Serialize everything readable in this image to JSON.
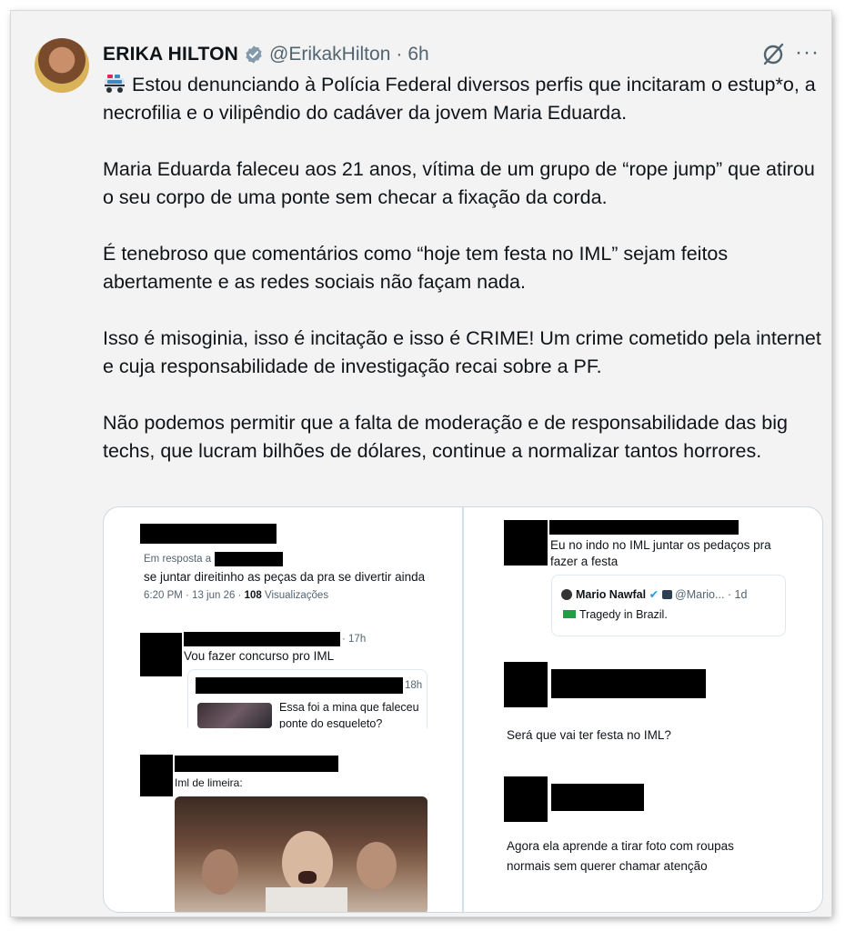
{
  "tweet": {
    "name": "ERIKA HILTON",
    "handle": "@ErikakHilton",
    "separator": "·",
    "time": "6h",
    "more_label": "···",
    "paragraphs": [
      "Estou denunciando à Polícia Federal diversos perfis que incitaram o estup*o, a necrofilia e o vilipêndio do cadáver da jovem Maria Eduarda.",
      "Maria Eduarda faleceu aos 21 anos, vítima de um grupo de “rope jump” que atirou o seu corpo de uma ponte sem checar a fixação da corda.",
      "É tenebroso que comentários como “hoje tem festa no IML” sejam feitos abertamente e as redes sociais não façam nada.",
      "Isso é misoginia, isso é incitação e isso é CRIME! Um crime cometido pela internet e cuja responsabilidade de investigação recai sobre a PF.",
      "Não podemos permitir que a falta de moderação e de responsabilidade das big techs, que lucram bilhões de dólares, continue a normalizar tantos horrores."
    ],
    "first_emoji": "police-car-emoji"
  },
  "media": {
    "left": {
      "post1": {
        "reply_to": "Em resposta a",
        "text": "se juntar direitinho as peças da pra se divertir ainda",
        "meta_time": "6:20 PM · 13 jun 26 · ",
        "views_count": "108",
        "views_label": " Visualizações"
      },
      "post2": {
        "time": "· 17h",
        "text": "Vou fazer concurso pro IML",
        "quote_time": "18h",
        "quote_text_1": "Essa foi a mina que faleceu",
        "quote_text_2": "ponte do esqueleto?"
      },
      "post3": {
        "text": "Iml de limeira:"
      }
    },
    "right": {
      "post1": {
        "text_1": "Eu no indo no IML juntar os pedaços pra",
        "text_2": "fazer a festa",
        "quote_name": "Mario Nawfal",
        "quote_handle": "@Mario... · 1d",
        "quote_text": "Tragedy in Brazil."
      },
      "post2": {
        "text": "Será que vai ter festa no IML?"
      },
      "post3": {
        "text_1": "Agora ela aprende a tirar foto com roupas",
        "text_2": "normais sem querer chamar atenção"
      }
    }
  },
  "colors": {
    "accent": "#1d9bf0",
    "muted": "#536471",
    "card_bg": "#f3f3f3"
  }
}
